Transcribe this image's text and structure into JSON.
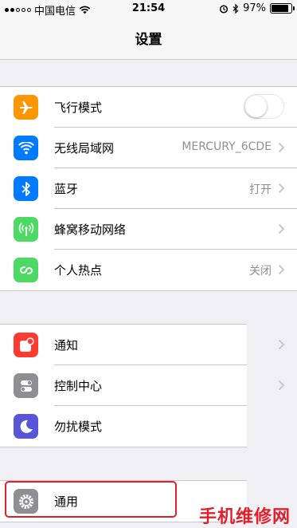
{
  "status_bar": {
    "carrier": "中国电信",
    "time": "21:54",
    "battery": "97%",
    "battery_level": 0.97
  },
  "nav": {
    "title": "设置"
  },
  "groups": [
    {
      "rows": [
        {
          "label": "飞行模式",
          "icon": "airplane-icon",
          "color": "#ff9500",
          "toggle": false
        },
        {
          "label": "无线局域网",
          "icon": "wifi-icon",
          "color": "#007aff",
          "detail": "MERCURY_6CDE"
        },
        {
          "label": "蓝牙",
          "icon": "bluetooth-icon",
          "color": "#007aff",
          "detail": "打开"
        },
        {
          "label": "蜂窝移动网络",
          "icon": "cellular-icon",
          "color": "#4cd964"
        },
        {
          "label": "个人热点",
          "icon": "hotspot-icon",
          "color": "#4cd964",
          "detail": "关闭"
        }
      ]
    },
    {
      "rows": [
        {
          "label": "通知",
          "icon": "notification-icon",
          "color": "#ff3b30"
        },
        {
          "label": "控制中心",
          "icon": "control-center-icon",
          "color": "#8e8e93"
        },
        {
          "label": "勿扰模式",
          "icon": "moon-icon",
          "color": "#5856d6"
        }
      ]
    },
    {
      "rows": [
        {
          "label": "通用",
          "icon": "gear-icon",
          "color": "#8e8e93"
        }
      ]
    }
  ],
  "watermark": "手机维修网"
}
